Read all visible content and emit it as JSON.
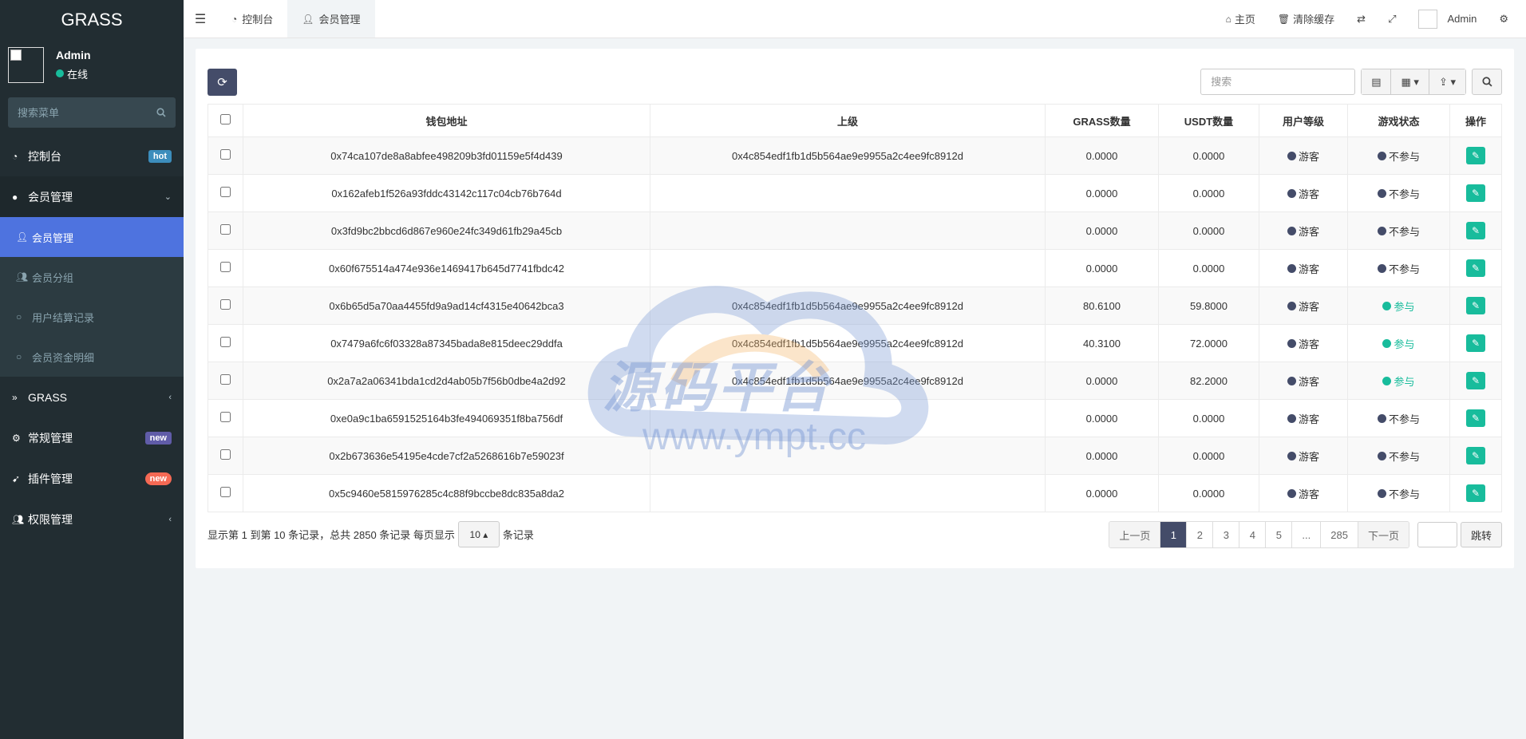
{
  "brand": "GRASS",
  "user": {
    "name": "Admin",
    "status": "在线",
    "status_color": "#18bc9c"
  },
  "sidebar_search_placeholder": "搜索菜单",
  "menu": {
    "dashboard": {
      "label": "控制台",
      "badge": "hot",
      "badge_color": "#3c8dbc"
    },
    "members": {
      "label": "会员管理"
    },
    "sub": [
      {
        "label": "会员管理"
      },
      {
        "label": "会员分组"
      },
      {
        "label": "用户结算记录"
      },
      {
        "label": "会员资金明细"
      }
    ],
    "grass": {
      "label": "GRASS"
    },
    "general": {
      "label": "常规管理",
      "badge": "new",
      "badge_color": "#605ca8"
    },
    "plugins": {
      "label": "插件管理",
      "badge": "new",
      "badge_color": "#f56954"
    },
    "auth": {
      "label": "权限管理"
    }
  },
  "header": {
    "tabs": [
      {
        "label": "控制台"
      },
      {
        "label": "会员管理"
      }
    ],
    "home": "主页",
    "clear_cache": "清除缓存",
    "admin": "Admin"
  },
  "toolbar": {
    "search_placeholder": "搜索"
  },
  "table": {
    "columns": [
      "钱包地址",
      "上级",
      "GRASS数量",
      "USDT数量",
      "用户等级",
      "游戏状态",
      "操作"
    ],
    "rows": [
      {
        "wallet": "0x74ca107de8a8abfee498209b3fd01159e5f4d439",
        "parent": "0x4c854edf1fb1d5b564ae9e9955a2c4ee9fc8912d",
        "grass": "0.0000",
        "usdt": "0.0000",
        "level": "游客",
        "status": "不参与",
        "on": false
      },
      {
        "wallet": "0x162afeb1f526a93fddc43142c117c04cb76b764d",
        "parent": "",
        "grass": "0.0000",
        "usdt": "0.0000",
        "level": "游客",
        "status": "不参与",
        "on": false
      },
      {
        "wallet": "0x3fd9bc2bbcd6d867e960e24fc349d61fb29a45cb",
        "parent": "",
        "grass": "0.0000",
        "usdt": "0.0000",
        "level": "游客",
        "status": "不参与",
        "on": false
      },
      {
        "wallet": "0x60f675514a474e936e1469417b645d7741fbdc42",
        "parent": "",
        "grass": "0.0000",
        "usdt": "0.0000",
        "level": "游客",
        "status": "不参与",
        "on": false
      },
      {
        "wallet": "0x6b65d5a70aa4455fd9a9ad14cf4315e40642bca3",
        "parent": "0x4c854edf1fb1d5b564ae9e9955a2c4ee9fc8912d",
        "grass": "80.6100",
        "usdt": "59.8000",
        "level": "游客",
        "status": "参与",
        "on": true
      },
      {
        "wallet": "0x7479a6fc6f03328a87345bada8e815deec29ddfa",
        "parent": "0x4c854edf1fb1d5b564ae9e9955a2c4ee9fc8912d",
        "grass": "40.3100",
        "usdt": "72.0000",
        "level": "游客",
        "status": "参与",
        "on": true
      },
      {
        "wallet": "0x2a7a2a06341bda1cd2d4ab05b7f56b0dbe4a2d92",
        "parent": "0x4c854edf1fb1d5b564ae9e9955a2c4ee9fc8912d",
        "grass": "0.0000",
        "usdt": "82.2000",
        "level": "游客",
        "status": "参与",
        "on": true
      },
      {
        "wallet": "0xe0a9c1ba6591525164b3fe494069351f8ba756df",
        "parent": "",
        "grass": "0.0000",
        "usdt": "0.0000",
        "level": "游客",
        "status": "不参与",
        "on": false
      },
      {
        "wallet": "0x2b673636e54195e4cde7cf2a5268616b7e59023f",
        "parent": "",
        "grass": "0.0000",
        "usdt": "0.0000",
        "level": "游客",
        "status": "不参与",
        "on": false
      },
      {
        "wallet": "0x5c9460e5815976285c4c88f9bccbe8dc835a8da2",
        "parent": "",
        "grass": "0.0000",
        "usdt": "0.0000",
        "level": "游客",
        "status": "不参与",
        "on": false
      }
    ]
  },
  "colors": {
    "dot_off": "#444c69",
    "dot_on": "#18bc9c"
  },
  "footer": {
    "info": "显示第 1 到第 10 条记录，总共 2850 条记录 每页显示",
    "page_size": "10",
    "info_suffix": "条记录"
  },
  "pager": {
    "prev": "上一页",
    "pages": [
      "1",
      "2",
      "3",
      "4",
      "5",
      "...",
      "285"
    ],
    "next": "下一页",
    "jump": "跳转"
  },
  "watermark": {
    "text": "源码平台",
    "url": "www.ympt.cc"
  }
}
